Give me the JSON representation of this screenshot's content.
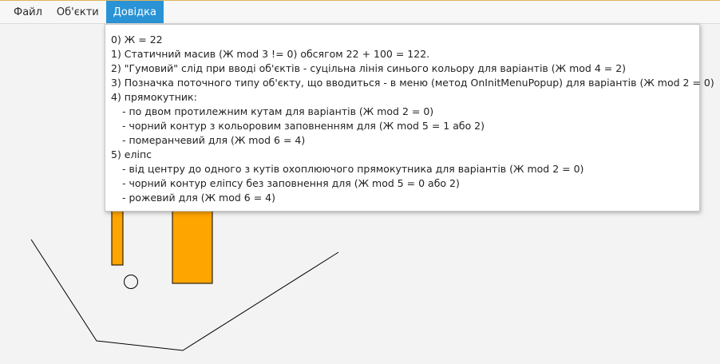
{
  "menubar": {
    "items": [
      {
        "label": "Файл",
        "active": false
      },
      {
        "label": "Об'єкти",
        "active": false
      },
      {
        "label": "Довідка",
        "active": true
      }
    ]
  },
  "help_menu": {
    "lines": [
      {
        "text": "0) Ж = 22",
        "indent": false
      },
      {
        "text": "1) Статичний масив (Ж mod 3 != 0) обсягом 22 + 100 = 122.",
        "indent": false
      },
      {
        "text": "2) \"Гумовий\" слід при вводі об'єктів - суцільна лінія синього кольору для варіантів (Ж mod 4 = 2)",
        "indent": false
      },
      {
        "text": "3) Позначка поточного типу об'єкту, що вводиться - в меню (метод OnInitMenuPopup) для варіантів (Ж mod 2 = 0)",
        "indent": false
      },
      {
        "text": "4) прямокутник:",
        "indent": false
      },
      {
        "text": "- по двом протилежним кутам для варіантів (Ж mod 2 = 0)",
        "indent": true
      },
      {
        "text": "- чорний контур з кольоровим заповненням для (Ж mod 5 = 1 або 2)",
        "indent": true
      },
      {
        "text": "- померанчевий для (Ж mod 6 = 4)",
        "indent": true
      },
      {
        "text": "5) еліпс",
        "indent": false
      },
      {
        "text": "- від центру до одного з кутів охоплюючого прямокутника для варіантів (Ж mod 2 = 0)",
        "indent": true
      },
      {
        "text": "- чорний контур еліпсу без заповнення для (Ж mod 5 = 0 або 2)",
        "indent": true
      },
      {
        "text": "- рожевий для (Ж mod 6 = 4)",
        "indent": true
      }
    ]
  },
  "colors": {
    "accent": "#2a93d5",
    "rect_fill": "#ffa500",
    "stroke": "#000000",
    "background": "#f3f3f3"
  }
}
